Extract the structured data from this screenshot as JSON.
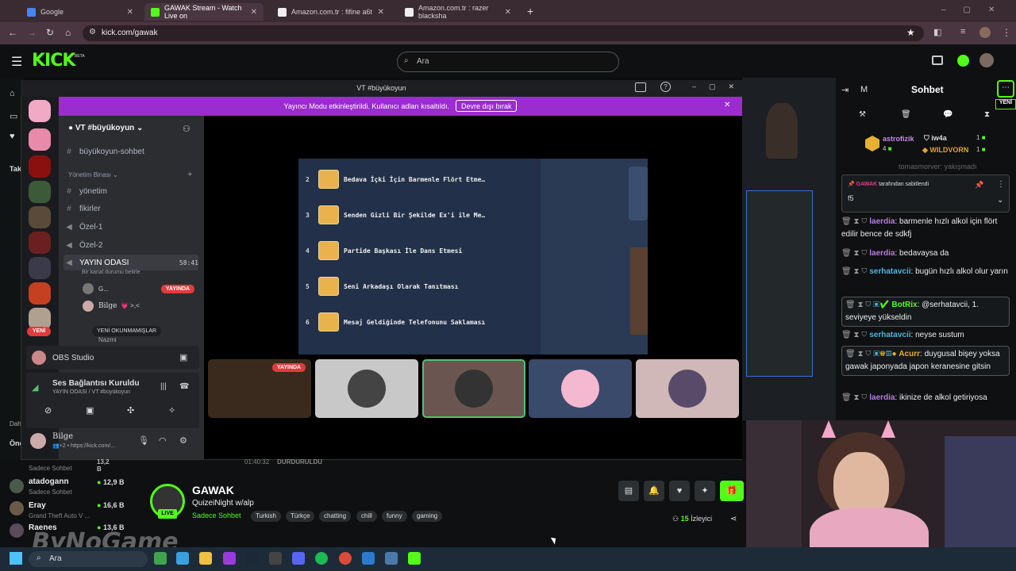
{
  "browser": {
    "tabs": [
      {
        "label": "Google",
        "color": "#4285f4"
      },
      {
        "label": "GAWAK Stream - Watch Live on",
        "color": "#53fc18"
      },
      {
        "label": "Amazon.com.tr : fifine a6t",
        "color": "#f0f0f0"
      },
      {
        "label": "Amazon.com.tr : razer blacksha",
        "color": "#f0f0f0"
      }
    ],
    "url": "kick.com/gawak"
  },
  "kick": {
    "logo": "KICK",
    "beta": "BETA",
    "search_placeholder": "Ara"
  },
  "discord": {
    "window_title": "VT #büyükoyun",
    "banner_text": "Yayıncı Modu etkinleştirildi. Kullanıcı adları kısaltıldı.",
    "banner_button": "Devre dışı bırak",
    "server_name": "VT #büyükoyun",
    "channels": {
      "sohbet": "büyükoyun-sohbet",
      "category": "Yönetim Binası",
      "yonetim": "yönetim",
      "fikirler": "fikirler",
      "ozel1": "Özel-1",
      "ozel2": "Özel-2",
      "yayin": "YAYIN ODASI",
      "yayin_time": "58:41",
      "status": "Bir kanal durumu belirle"
    },
    "members": {
      "m1": "G...",
      "live": "YAYINDA",
      "m2": "Bilge",
      "m2_status": "💗 >,<",
      "m3": "Nazmi",
      "unread": "YENİ OKUNMAMIŞLAR",
      "new_badge": "YENİ"
    },
    "obs": "OBS Studio",
    "voice": {
      "title": "Ses Bağlantısı Kuruldu",
      "sub": "YAYIN ODASI / VT #büyükoyun"
    },
    "user": {
      "name": "Bilge",
      "sub": "👥+2 • https://kick.com/..."
    },
    "tile_live": "YAYINDA"
  },
  "stage_items": [
    {
      "n": "2",
      "t": "Bedava İçki İçin Barmenle Flört Etme…"
    },
    {
      "n": "3",
      "t": "Senden Gizli Bir Şekilde Ex'i ile Me…"
    },
    {
      "n": "4",
      "t": "Partide Başkası İle Dans Etmesi"
    },
    {
      "n": "5",
      "t": "Seni Arkadaşı Olarak Tanıtması"
    },
    {
      "n": "6",
      "t": "Mesaj Geldiğinde Telefonunu Saklaması"
    }
  ],
  "stream": {
    "name": "GAWAK",
    "title": "QuizeiNight w/alp",
    "category": "Sadece Sohbet",
    "tags": [
      "Turkish",
      "Türkçe",
      "chatting",
      "chill",
      "funny",
      "gaming"
    ],
    "viewers": "15",
    "viewers_label": "İzleyici",
    "live": "LIVE",
    "time": "01:40:32",
    "status": "DURDURULDU"
  },
  "sidebar_label": {
    "taki": "Takı",
    "dah": "Dah",
    "one": "Öne"
  },
  "sidebar_channels": [
    {
      "name": "atadogann",
      "cat": "Sadece Sohbet",
      "viewers": "12,9 B"
    },
    {
      "name": "Eray",
      "cat": "Grand Theft Auto V ...",
      "viewers": "16,6 B"
    },
    {
      "name": "Raenes",
      "cat": "",
      "viewers": "13,6 B"
    }
  ],
  "sidebar_prev": {
    "cat": "Sadece Sohbet",
    "viewers": "13,2 B"
  },
  "chat": {
    "header": "Sohbet",
    "m_label": "M",
    "top_users": [
      {
        "name": "astrofizik",
        "pts": "4"
      },
      {
        "name": "iw4a",
        "pts": "1"
      },
      {
        "name": "WILDVORN",
        "pts": "1"
      }
    ],
    "pinned_by": "GAWAK",
    "pinned_label": "tarafından sabitlendi",
    "pinned_msg": "f5",
    "ghost": "tomasmorver: yakışmadı",
    "messages": [
      {
        "user": "laerdia",
        "text": ": barmenle hızlı alkol için flört edilir bence de sdkfj",
        "cls": "user1"
      },
      {
        "user": "laerdia",
        "text": ": bedavaysa da",
        "cls": "user1"
      },
      {
        "user": "serhatavcii",
        "text": ": bugün hızlı alkol olur yarın",
        "cls": "user2"
      },
      {
        "user": "BotRix",
        "text": ": @serhatavcii, 1. seviyeye yükseldin",
        "cls": "user3"
      },
      {
        "user": "serhatavcii",
        "text": ": neyse sustum",
        "cls": "user2"
      },
      {
        "user": "Acurr",
        "text": ": duygusal bişey yoksa gawak japonyada japon keranesine gitsin",
        "cls": "user4"
      },
      {
        "user": "laerdia",
        "text": ": ikinize de alkol getiriyosa",
        "cls": "user1"
      }
    ],
    "new_label": "YENİ"
  },
  "taskbar": {
    "search": "Ara"
  },
  "watermark": "ByNoGame"
}
